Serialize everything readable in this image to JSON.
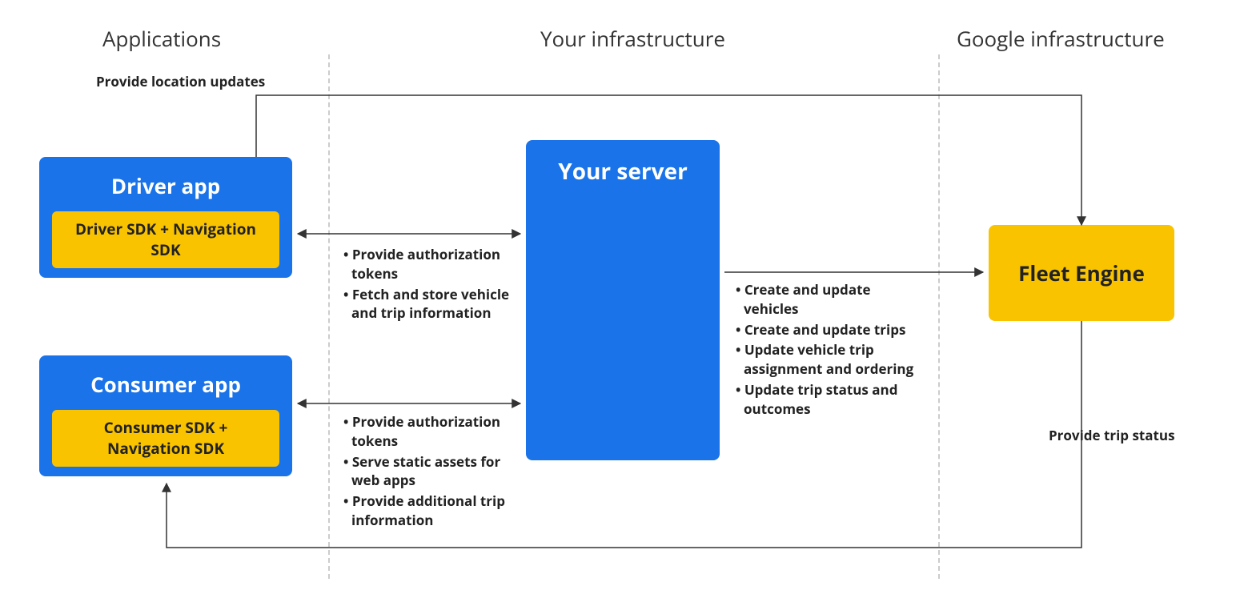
{
  "sections": {
    "applications": "Applications",
    "your_infra": "Your infrastructure",
    "google_infra": "Google infrastructure"
  },
  "driver_app": {
    "title": "Driver app",
    "sdk": "Driver SDK + Navigation SDK"
  },
  "consumer_app": {
    "title": "Consumer app",
    "sdk": "Consumer SDK + Navigation SDK"
  },
  "server": {
    "title": "Your server"
  },
  "fleet": {
    "title": "Fleet Engine"
  },
  "labels": {
    "top": "Provide location updates",
    "bottom": "Provide trip status"
  },
  "bullets_driver": [
    "Provide authorization tokens",
    "Fetch and store vehicle and trip information"
  ],
  "bullets_consumer": [
    "Provide authorization tokens",
    "Serve static assets for web apps",
    "Provide additional trip information"
  ],
  "bullets_server": [
    "Create and update vehicles",
    "Create and update trips",
    "Update vehicle trip assignment and ordering",
    "Update trip status and outcomes"
  ]
}
